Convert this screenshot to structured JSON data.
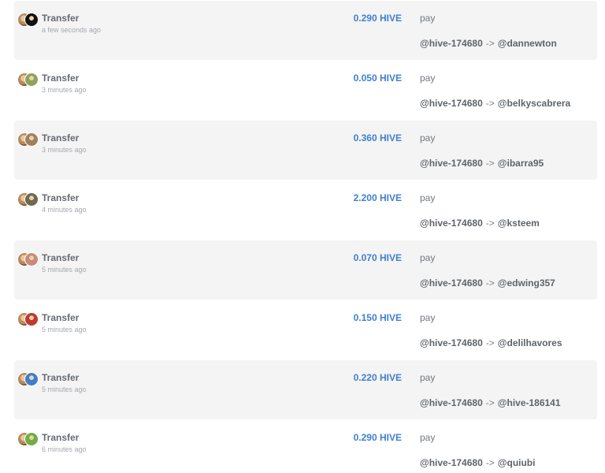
{
  "feed": {
    "items": [
      {
        "type": "Transfer",
        "time": "a few seconds ago",
        "amount": "0.290 HIVE",
        "memo": "pay",
        "from": "@hive-174680",
        "arrow": "->",
        "to": "@dannewton",
        "avatar2_color": "#111111"
      },
      {
        "type": "Transfer",
        "time": "3 minutes ago",
        "amount": "0.050 HIVE",
        "memo": "pay",
        "from": "@hive-174680",
        "arrow": "->",
        "to": "@belkyscabrera",
        "avatar2_color": "#8fa35a"
      },
      {
        "type": "Transfer",
        "time": "3 minutes ago",
        "amount": "0.360 HIVE",
        "memo": "pay",
        "from": "@hive-174680",
        "arrow": "->",
        "to": "@ibarra95",
        "avatar2_color": "#a0805f"
      },
      {
        "type": "Transfer",
        "time": "4 minutes ago",
        "amount": "2.200 HIVE",
        "memo": "pay",
        "from": "@hive-174680",
        "arrow": "->",
        "to": "@ksteem",
        "avatar2_color": "#6e6a4f"
      },
      {
        "type": "Transfer",
        "time": "5 minutes ago",
        "amount": "0.070 HIVE",
        "memo": "pay",
        "from": "@hive-174680",
        "arrow": "->",
        "to": "@edwing357",
        "avatar2_color": "#c98c77"
      },
      {
        "type": "Transfer",
        "time": "5 minutes ago",
        "amount": "0.150 HIVE",
        "memo": "pay",
        "from": "@hive-174680",
        "arrow": "->",
        "to": "@delilhavores",
        "avatar2_color": "#c0392b"
      },
      {
        "type": "Transfer",
        "time": "5 minutes ago",
        "amount": "0.220 HIVE",
        "memo": "pay",
        "from": "@hive-174680",
        "arrow": "->",
        "to": "@hive-186141",
        "avatar2_color": "#3d7fc9"
      },
      {
        "type": "Transfer",
        "time": "6 minutes ago",
        "amount": "0.290 HIVE",
        "memo": "pay",
        "from": "@hive-174680",
        "arrow": "->",
        "to": "@quiubi",
        "avatar2_color": "#6fae3f"
      }
    ]
  }
}
